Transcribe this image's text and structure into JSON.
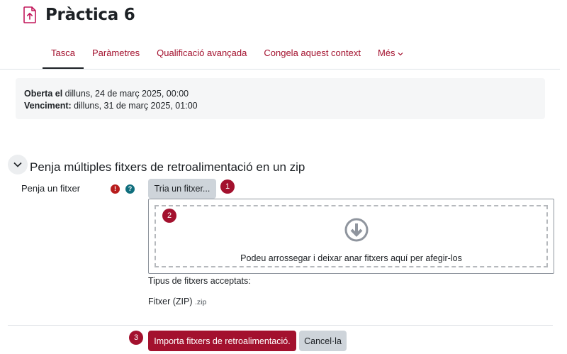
{
  "page": {
    "title": "Pràctica 6",
    "icon": "assignment-upload-icon",
    "accent_color": "#a3112e"
  },
  "nav": {
    "tabs": [
      "Tasca",
      "Paràmetres",
      "Qualificació avançada",
      "Congela aquest context"
    ],
    "more_label": "Més",
    "active": "Tasca"
  },
  "dates": {
    "opened_label": "Oberta el",
    "opened_value": "dilluns, 24 de març 2025, 00:00",
    "due_label": "Venciment:",
    "due_value": "dilluns, 31 de març 2025, 01:00"
  },
  "section": {
    "title": "Penja múltiples fitxers de retroalimentació en un zip"
  },
  "upload": {
    "field_label": "Penja un fitxer",
    "required_mark": "!",
    "help_mark": "?",
    "choose_button": "Tria un fitxer...",
    "drop_text": "Podeu arrossegar i deixar anar fitxers aquí per afegir-los",
    "accepted_title": "Tipus de fitxers acceptats:",
    "accepted_type": "Fitxer (ZIP)",
    "accepted_ext": ".zip"
  },
  "actions": {
    "import_button": "Importa fitxers de retroalimentació.",
    "cancel_button": "Cancel·la"
  },
  "badges": [
    "1",
    "2",
    "3"
  ]
}
